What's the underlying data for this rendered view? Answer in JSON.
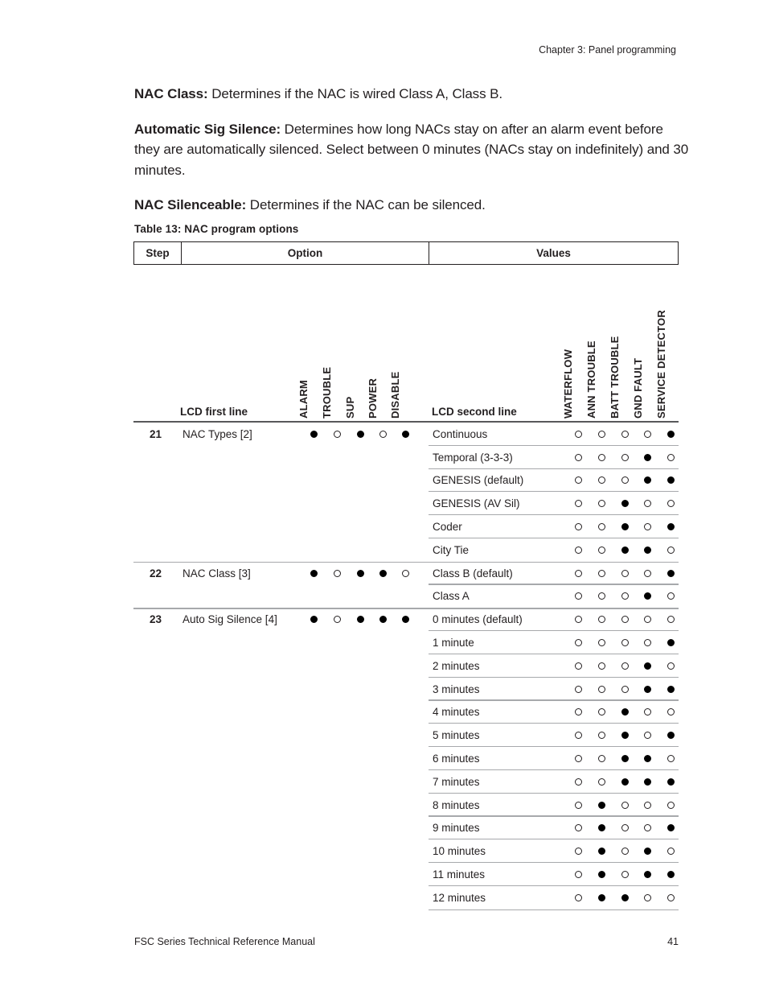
{
  "running_head": "Chapter 3: Panel programming",
  "paragraphs": [
    {
      "term": "NAC Class:",
      "text": " Determines if the NAC is wired Class A, Class B."
    },
    {
      "term": "Automatic Sig Silence:",
      "text": " Determines how long NACs stay on after an alarm event before they are automatically silenced. Select between 0 minutes (NACs stay on indefinitely) and 30 minutes."
    },
    {
      "term": "NAC Silenceable:",
      "text": " Determines if the NAC can be silenced."
    }
  ],
  "table": {
    "caption": "Table 13: NAC program options",
    "headers": {
      "step": "Step",
      "option": "Option",
      "values": "Values"
    },
    "subheaders": {
      "lcd_first_line": "LCD first line",
      "lcd_second_line": "LCD second line",
      "left_leds": [
        "ALARM",
        "TROUBLE",
        "SUP",
        "POWER",
        "DISABLE"
      ],
      "right_leds": [
        "WATERFLOW",
        "ANN TROUBLE",
        "BATT TROUBLE",
        "GND FAULT",
        "SERVICE DETECTOR"
      ]
    },
    "groups": [
      {
        "step": "21",
        "option": "NAC Types [2]",
        "option_leds": [
          1,
          0,
          1,
          0,
          1
        ],
        "values": [
          {
            "label": "Continuous",
            "leds": [
              0,
              0,
              0,
              0,
              1
            ]
          },
          {
            "label": "Temporal (3-3-3)",
            "leds": [
              0,
              0,
              0,
              1,
              0
            ]
          },
          {
            "label": "GENESIS (default)",
            "leds": [
              0,
              0,
              0,
              1,
              1
            ]
          },
          {
            "label": "GENESIS (AV Sil)",
            "leds": [
              0,
              0,
              1,
              0,
              0
            ]
          },
          {
            "label": "Coder",
            "leds": [
              0,
              0,
              1,
              0,
              1
            ]
          },
          {
            "label": "City Tie",
            "leds": [
              0,
              0,
              1,
              1,
              0
            ]
          }
        ]
      },
      {
        "step": "22",
        "option": "NAC Class [3]",
        "option_leds": [
          1,
          0,
          1,
          1,
          0
        ],
        "values": [
          {
            "label": "Class B (default)",
            "leds": [
              0,
              0,
              0,
              0,
              1
            ]
          },
          {
            "label": "Class A",
            "leds": [
              0,
              0,
              0,
              1,
              0
            ]
          }
        ]
      },
      {
        "step": "23",
        "option": "Auto Sig Silence [4]",
        "option_leds": [
          1,
          0,
          1,
          1,
          1
        ],
        "values": [
          {
            "label": "0 minutes (default)",
            "leds": [
              0,
              0,
              0,
              0,
              0
            ]
          },
          {
            "label": "1 minute",
            "leds": [
              0,
              0,
              0,
              0,
              1
            ]
          },
          {
            "label": "2 minutes",
            "leds": [
              0,
              0,
              0,
              1,
              0
            ]
          },
          {
            "label": "3 minutes",
            "leds": [
              0,
              0,
              0,
              1,
              1
            ]
          },
          {
            "label": "4 minutes",
            "leds": [
              0,
              0,
              1,
              0,
              0
            ]
          },
          {
            "label": "5 minutes",
            "leds": [
              0,
              0,
              1,
              0,
              1
            ]
          },
          {
            "label": "6 minutes",
            "leds": [
              0,
              0,
              1,
              1,
              0
            ]
          },
          {
            "label": "7 minutes",
            "leds": [
              0,
              0,
              1,
              1,
              1
            ]
          },
          {
            "label": "8 minutes",
            "leds": [
              0,
              1,
              0,
              0,
              0
            ]
          },
          {
            "label": "9 minutes",
            "leds": [
              0,
              1,
              0,
              0,
              1
            ]
          },
          {
            "label": "10 minutes",
            "leds": [
              0,
              1,
              0,
              1,
              0
            ]
          },
          {
            "label": "11 minutes",
            "leds": [
              0,
              1,
              0,
              1,
              1
            ]
          },
          {
            "label": "12 minutes",
            "leds": [
              0,
              1,
              1,
              0,
              0
            ]
          }
        ]
      }
    ]
  },
  "footer": {
    "manual": "FSC Series Technical Reference Manual",
    "page": "41"
  }
}
